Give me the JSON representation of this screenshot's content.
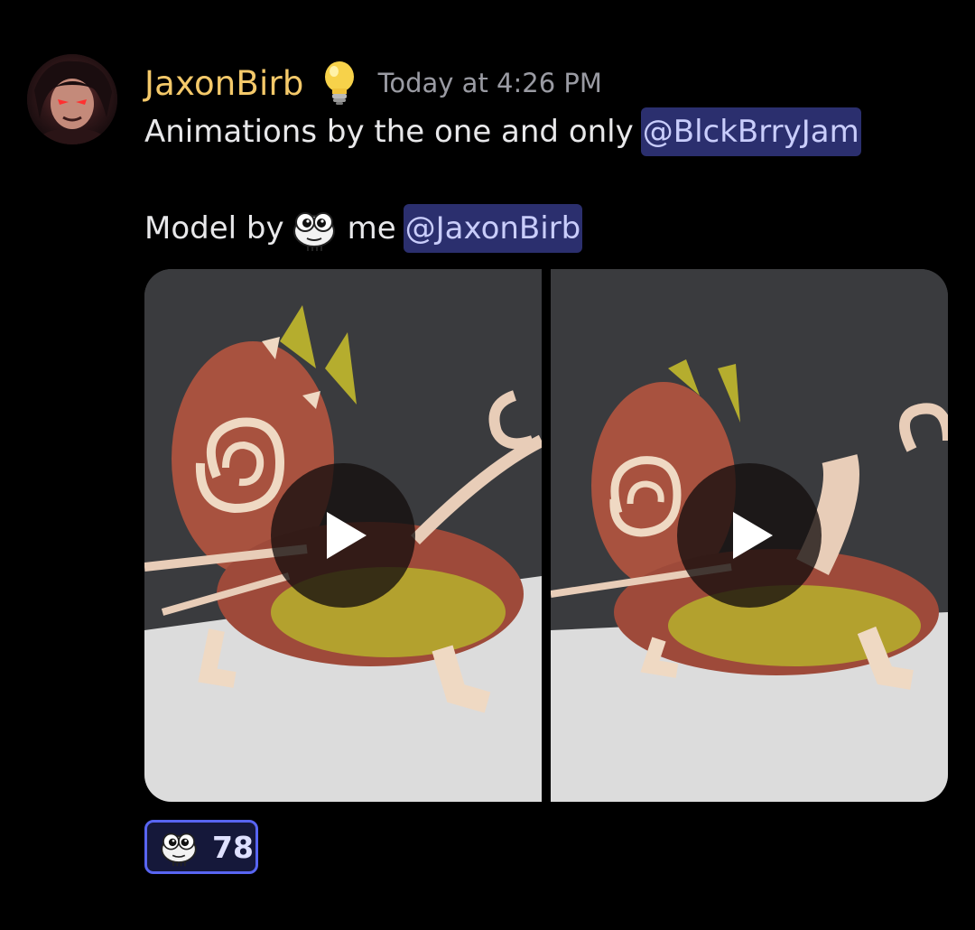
{
  "message": {
    "author": {
      "name": "JaxonBirb",
      "name_color": "#f4c96a",
      "badge_icon": "lightbulb-icon",
      "avatar_icon": "avatar"
    },
    "timestamp": "Today at 4:26 PM",
    "content": {
      "line1_text": "Animations by the one and only",
      "line1_mention": "@BlckBrryJam",
      "line2_text_before": "Model by",
      "line2_emoji": "bug-eyed-creature-emoji",
      "line2_text_after": "me",
      "line2_mention": "@JaxonBirb"
    },
    "attachments": [
      {
        "type": "video",
        "thumbnail": "3D rendered creature with spiral shell",
        "play_icon": "play-icon"
      },
      {
        "type": "video",
        "thumbnail": "3D rendered creature with spiral shell",
        "play_icon": "play-icon"
      }
    ],
    "reactions": [
      {
        "emoji": "bug-eyed-creature-emoji",
        "count": "78",
        "reacted": true
      }
    ]
  },
  "colors": {
    "background": "#000000",
    "mention_bg": "#2b2f6e",
    "mention_text": "#c9cdfb",
    "timestamp": "#9a9ba3",
    "reaction_border": "#5865f2",
    "reaction_bg": "#15183a"
  }
}
